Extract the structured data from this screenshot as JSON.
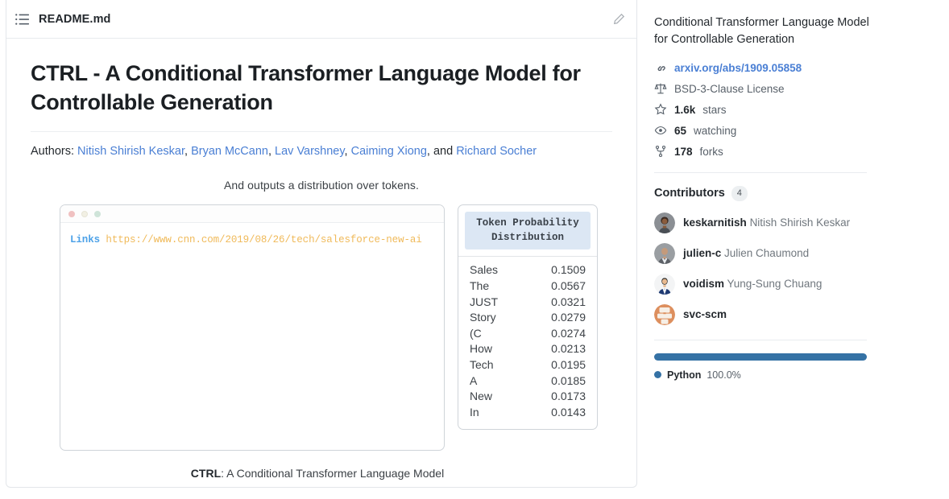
{
  "readme": {
    "toc_icon": "list-icon",
    "filename": "README.md",
    "edit_icon": "pencil-icon",
    "title": "CTRL - A Conditional Transformer Language Model for Controllable Generation",
    "authors_label": "Authors:",
    "authors": [
      {
        "name": "Nitish Shirish Keskar",
        "sep": ", "
      },
      {
        "name": "Bryan McCann",
        "sep": ", "
      },
      {
        "name": "Lav Varshney",
        "sep": ", "
      },
      {
        "name": "Caiming Xiong",
        "sep": ", and "
      },
      {
        "name": "Richard Socher",
        "sep": ""
      }
    ]
  },
  "figure": {
    "top_text": "And outputs a distribution over tokens.",
    "mock": {
      "dots": [
        "red",
        "yellow",
        "green"
      ],
      "code_keyword": "Links",
      "code_url": "https://www.cnn.com/2019/08/26/tech/salesforce-new-ai"
    },
    "token_table": {
      "header": "Token Probability Distribution",
      "header_line1": "Token Probability",
      "header_line2": "Distribution",
      "rows": [
        {
          "token": "Sales",
          "prob": "0.1509"
        },
        {
          "token": "The",
          "prob": "0.0567"
        },
        {
          "token": "JUST",
          "prob": "0.0321"
        },
        {
          "token": "Story",
          "prob": "0.0279"
        },
        {
          "token": "(C",
          "prob": "0.0274"
        },
        {
          "token": "How",
          "prob": "0.0213"
        },
        {
          "token": "Tech",
          "prob": "0.0195"
        },
        {
          "token": "A",
          "prob": "0.0185"
        },
        {
          "token": "New",
          "prob": "0.0173"
        },
        {
          "token": "In",
          "prob": "0.0143"
        }
      ]
    },
    "caption_bold": "CTRL",
    "caption_rest": ": A Conditional Transformer Language Model"
  },
  "sidebar": {
    "description": "Conditional Transformer Language Model for Controllable Generation",
    "link": {
      "icon": "link-icon",
      "text": "arxiv.org/abs/1909.05858"
    },
    "meta": [
      {
        "icon": "law-icon",
        "strong": "",
        "text": "BSD-3-Clause License"
      },
      {
        "icon": "star-icon",
        "strong": "1.6k",
        "text": "stars"
      },
      {
        "icon": "eye-icon",
        "strong": "65",
        "text": "watching"
      },
      {
        "icon": "fork-icon",
        "strong": "178",
        "text": "forks"
      }
    ],
    "contributors": {
      "heading": "Contributors",
      "count": "4",
      "items": [
        {
          "login": "keskarnitish",
          "name": "Nitish Shirish Keskar",
          "avatar": "avatar-keskarnitish"
        },
        {
          "login": "julien-c",
          "name": "Julien Chaumond",
          "avatar": "avatar-julien-c"
        },
        {
          "login": "voidism",
          "name": "Yung-Sung Chuang",
          "avatar": "avatar-voidism"
        },
        {
          "login": "svc-scm",
          "name": "",
          "avatar": "avatar-svc-scm"
        }
      ]
    },
    "languages": [
      {
        "name": "Python",
        "percent": "100.0%",
        "color": "#3572a5",
        "width": "100%"
      }
    ]
  }
}
